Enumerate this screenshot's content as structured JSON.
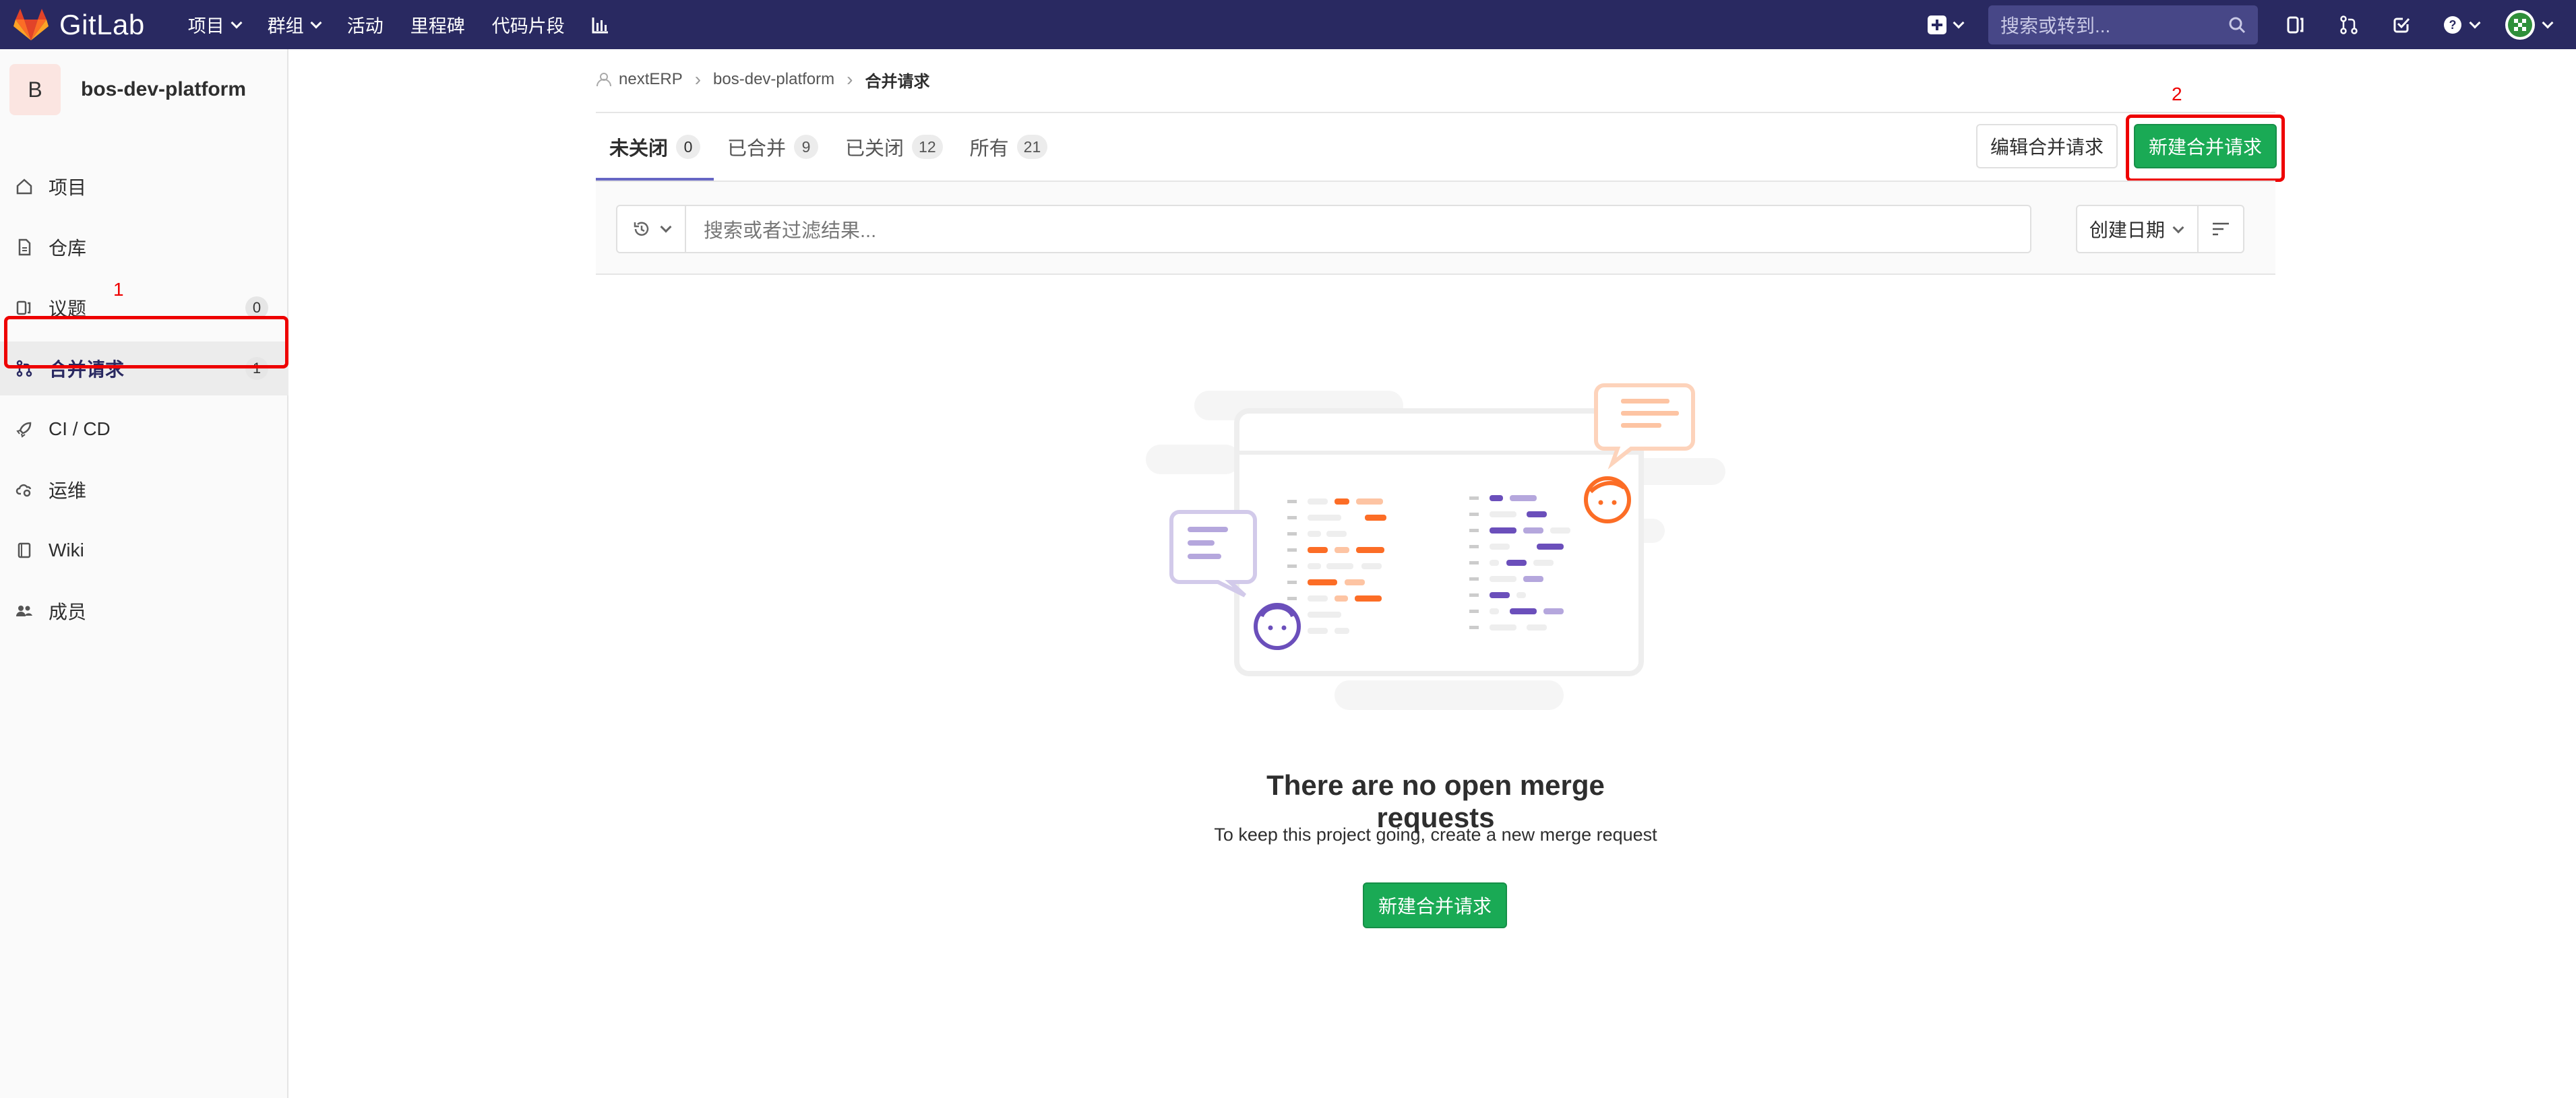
{
  "navbar": {
    "brand": "GitLab",
    "items": [
      {
        "label": "项目",
        "dropdown": true
      },
      {
        "label": "群组",
        "dropdown": true
      },
      {
        "label": "活动",
        "dropdown": false
      },
      {
        "label": "里程碑",
        "dropdown": false
      },
      {
        "label": "代码片段",
        "dropdown": false
      }
    ],
    "search_placeholder": "搜索或转到..."
  },
  "sidebar": {
    "project_initial": "B",
    "project_name": "bos-dev-platform",
    "items": [
      {
        "label": "项目",
        "icon": "home-icon"
      },
      {
        "label": "仓库",
        "icon": "doc-icon"
      },
      {
        "label": "议题",
        "icon": "issues-icon",
        "count": "0"
      },
      {
        "label": "合并请求",
        "icon": "merge-request-icon",
        "count": "1",
        "active": true
      },
      {
        "label": "CI / CD",
        "icon": "rocket-icon"
      },
      {
        "label": "运维",
        "icon": "cloud-gear-icon"
      },
      {
        "label": "Wiki",
        "icon": "book-icon"
      },
      {
        "label": "成员",
        "icon": "users-icon"
      }
    ]
  },
  "annotations": {
    "sidebar_marker": "1",
    "button_marker": "2",
    "highlight_color": "#ee0000"
  },
  "breadcrumb": {
    "group": "nextERP",
    "project": "bos-dev-platform",
    "current": "合并请求"
  },
  "tabs": [
    {
      "label": "未关闭",
      "count": "0",
      "active": true
    },
    {
      "label": "已合并",
      "count": "9"
    },
    {
      "label": "已关闭",
      "count": "12"
    },
    {
      "label": "所有",
      "count": "21"
    }
  ],
  "actions": {
    "edit_label": "编辑合并请求",
    "new_label": "新建合并请求"
  },
  "filter": {
    "placeholder": "搜索或者过滤结果...",
    "sort_label": "创建日期"
  },
  "empty_state": {
    "title": "There are no open merge requests",
    "description": "To keep this project going, create a new merge request",
    "button_label": "新建合并请求"
  },
  "colors": {
    "navbar": "#292961",
    "primary_green": "#1aaa55",
    "active_tab": "#6666c4"
  }
}
